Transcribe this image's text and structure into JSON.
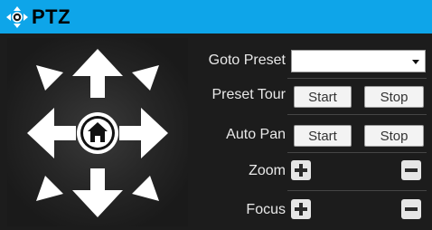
{
  "title": "PTZ",
  "accent_color": "#0ea5e9",
  "icons": {
    "title": "move-arrows-icon",
    "home": "home-icon",
    "up": "arrow-up-icon",
    "down": "arrow-down-icon",
    "left": "arrow-left-icon",
    "right": "arrow-right-icon",
    "up_left": "arrow-up-left-icon",
    "up_right": "arrow-up-right-icon",
    "down_left": "arrow-down-left-icon",
    "down_right": "arrow-down-right-icon",
    "plus": "plus-icon",
    "minus": "minus-icon",
    "dropdown": "chevron-down-icon"
  },
  "controls": {
    "goto_preset": {
      "label": "Goto Preset",
      "value": ""
    },
    "preset_tour": {
      "label": "Preset Tour",
      "start": "Start",
      "stop": "Stop"
    },
    "auto_pan": {
      "label": "Auto Pan",
      "start": "Start",
      "stop": "Stop"
    },
    "zoom": {
      "label": "Zoom"
    },
    "focus": {
      "label": "Focus"
    }
  }
}
